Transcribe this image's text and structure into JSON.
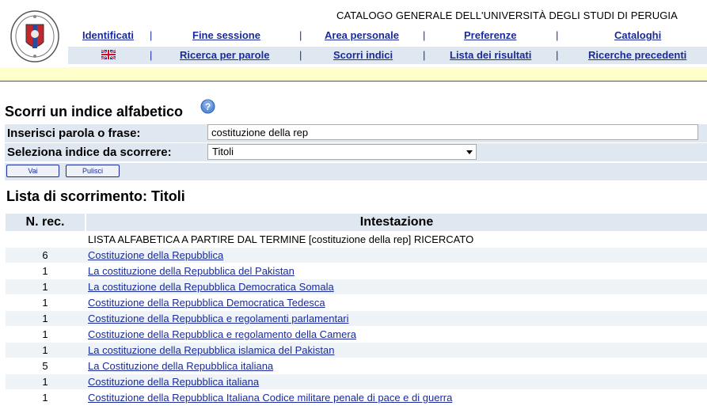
{
  "header": {
    "site_title": "CATALOGO GENERALE DELL'UNIVERSITÀ DEGLI STUDI DI PERUGIA",
    "nav_row1": [
      "Identificati",
      "Fine sessione",
      "Area personale",
      "Preferenze",
      "Cataloghi"
    ],
    "nav_row2": [
      "Ricerca per parole",
      "Scorri indici",
      "Lista dei risultati",
      "Ricerche precedenti"
    ],
    "separator": "|",
    "language_icon": "uk-flag-icon",
    "logo_icon": "university-seal-icon"
  },
  "search": {
    "title": "Scorri un indice alfabetico",
    "help_icon": "help-icon",
    "phrase_label": "Inserisci parola o frase:",
    "phrase_value": "costituzione della rep",
    "index_label": "Seleziona indice da scorrere:",
    "index_selected": "Titoli",
    "go_button": "Vai",
    "clear_button": "Pulisci"
  },
  "results": {
    "title": "Lista di scorrimento: Titoli",
    "col_num": "N. rec.",
    "col_heading": "Intestazione",
    "intro": "LISTA ALFABETICA A PARTIRE DAL TERMINE [costituzione della rep] RICERCATO",
    "rows": [
      {
        "count": "6",
        "title": "Costituzione della Repubblica"
      },
      {
        "count": "1",
        "title": "La costituzione della Repubblica del Pakistan"
      },
      {
        "count": "1",
        "title": "La costituzione della Repubblica Democratica Somala"
      },
      {
        "count": "1",
        "title": "Costituzione della Repubblica Democratica Tedesca"
      },
      {
        "count": "1",
        "title": "Costituzione della Repubblica e regolamenti parlamentari"
      },
      {
        "count": "1",
        "title": "Costituzione della Repubblica e regolamento della Camera"
      },
      {
        "count": "1",
        "title": "La costituzione della Repubblica islamica del Pakistan"
      },
      {
        "count": "5",
        "title": "La Costituzione della Repubblica italiana"
      },
      {
        "count": "1",
        "title": "Costituzione della Repubblica italiana"
      },
      {
        "count": "1",
        "title": "Costituzione della Repubblica Italiana Codice militare penale di pace e di guerra"
      }
    ]
  },
  "colors": {
    "link": "#1a2a99",
    "row_band": "#dfe8f1",
    "strip": "#ffffcc"
  }
}
